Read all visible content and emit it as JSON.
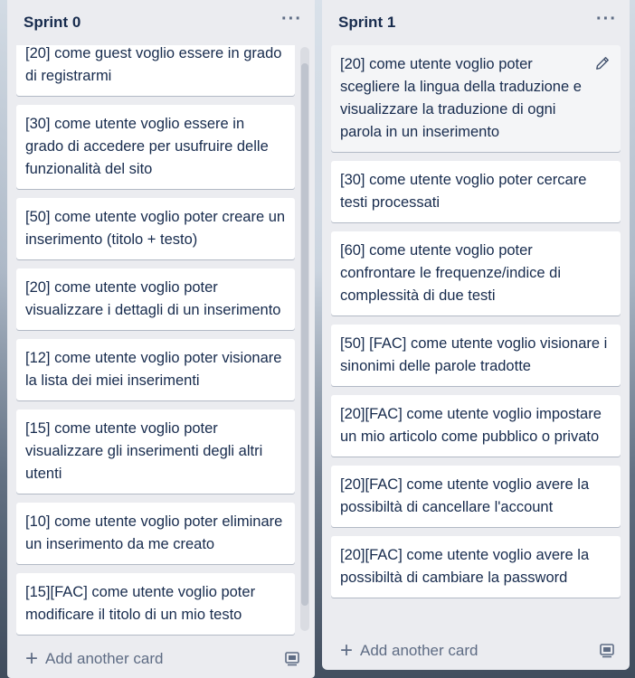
{
  "lists": [
    {
      "title": "Sprint 0",
      "menu": "···",
      "cards": [
        "[20] come guest voglio essere in grado di registrarmi",
        "[30] come utente voglio essere in grado di accedere per usufruire delle funzionalità del sito",
        "[50] come utente voglio poter creare un inserimento (titolo + testo)",
        "[20] come utente voglio poter visualizzare i dettagli di un inserimento",
        "[12] come utente voglio poter visionare la lista dei miei inserimenti",
        "[15] come utente voglio poter visualizzare gli inserimenti degli altri utenti",
        "[10] come utente voglio poter eliminare un inserimento da me creato",
        "[15][FAC] come utente voglio poter modificare il titolo di un mio testo"
      ],
      "add_label": "Add another card"
    },
    {
      "title": "Sprint 1",
      "menu": "···",
      "cards": [
        "[20] come utente voglio poter scegliere la lingua della traduzione e visualizzare la traduzione di ogni parola in un inserimento",
        "[30] come utente voglio poter cercare testi processati",
        "[60] come utente voglio poter confrontare le frequenze/indice di complessità di due testi",
        "[50] [FAC] come utente voglio visionare i sinonimi delle parole tradotte",
        "[20][FAC] come utente voglio impostare un mio articolo come pubblico o privato",
        "[20][FAC] come utente voglio avere la possibiltà di cancellare l'account",
        "[20][FAC] come utente voglio avere la possibiltà di cambiare la password"
      ],
      "add_label": "Add another card"
    }
  ],
  "icons": {
    "edit": "pencil-icon",
    "template": "card-template-icon",
    "add": "plus-icon"
  }
}
